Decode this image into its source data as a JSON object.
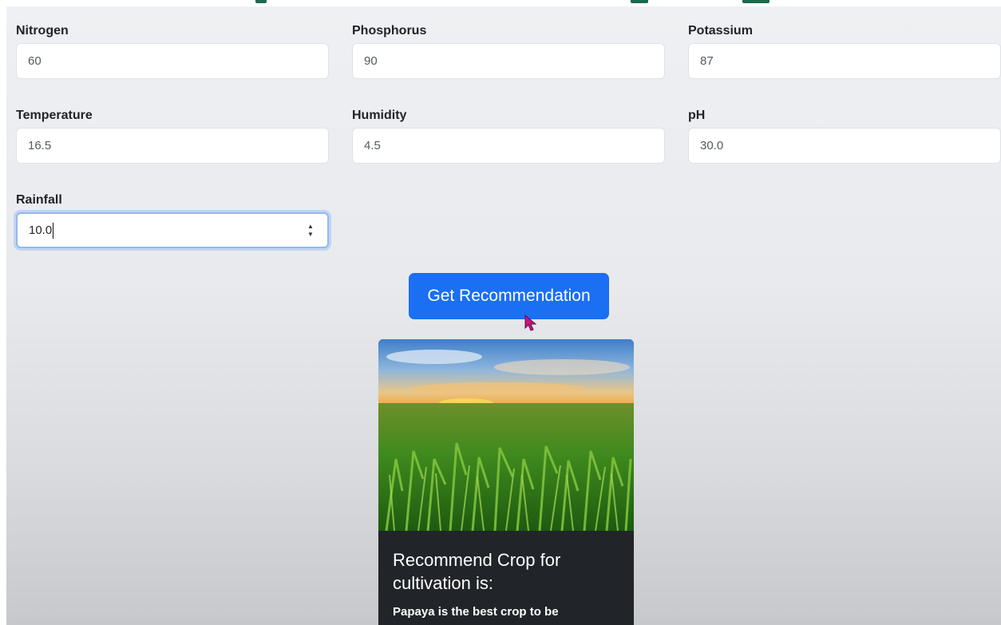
{
  "form": {
    "fields": [
      {
        "label": "Nitrogen",
        "value": "60"
      },
      {
        "label": "Phosphorus",
        "value": "90"
      },
      {
        "label": "Potassium",
        "value": "87"
      },
      {
        "label": "Temperature",
        "value": "16.5"
      },
      {
        "label": "Humidity",
        "value": "4.5"
      },
      {
        "label": "pH",
        "value": "30.0"
      },
      {
        "label": "Rainfall",
        "value": "10.0"
      }
    ],
    "submit_label": "Get Recommendation"
  },
  "result": {
    "title": "Recommend Crop for cultivation is:",
    "text": "Papaya is the best crop to be"
  },
  "icons": {
    "spinner": "number-spinner-icon",
    "cursor": "mouse-pointer-icon"
  },
  "colors": {
    "accent": "#1a6ff3",
    "card_bg": "#212529",
    "cursor": "#c2187a"
  }
}
